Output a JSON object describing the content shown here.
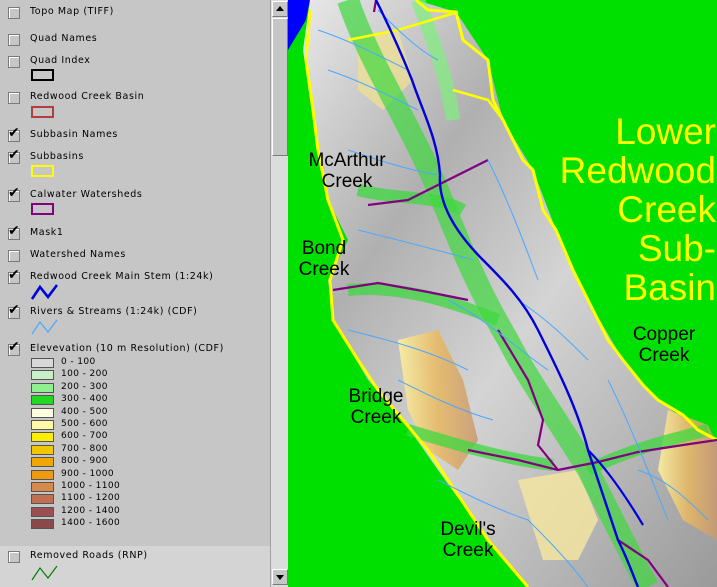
{
  "legend": {
    "layers": [
      {
        "name": "Topo Map (TIFF)",
        "checked": false
      },
      {
        "name": "Quad Names",
        "checked": false
      },
      {
        "name": "Quad Index",
        "checked": false
      },
      {
        "name": "Redwood Creek Basin",
        "checked": false
      },
      {
        "name": "Subbasin Names",
        "checked": true
      },
      {
        "name": "Subbasins",
        "checked": true
      },
      {
        "name": "Calwater Watersheds",
        "checked": true
      },
      {
        "name": "Mask1",
        "checked": true
      },
      {
        "name": "Watershed Names",
        "checked": false
      },
      {
        "name": "Redwood Creek Main Stem (1:24k)",
        "checked": true
      },
      {
        "name": "Rivers & Streams (1:24k) (CDF)",
        "checked": true
      },
      {
        "name": "Elevevation (10 m Resolution) (CDF)",
        "checked": true
      },
      {
        "name": "Removed Roads (RNP)",
        "checked": false
      }
    ],
    "elevation_classes": [
      {
        "label": "0 - 100",
        "color": "#d8d8d8"
      },
      {
        "label": "100 - 200",
        "color": "#c8f0c8"
      },
      {
        "label": "200 - 300",
        "color": "#90f090"
      },
      {
        "label": "300 - 400",
        "color": "#22d822"
      },
      {
        "label": "400 - 500",
        "color": "#fffde0"
      },
      {
        "label": "500 - 600",
        "color": "#fff8a8"
      },
      {
        "label": "600 - 700",
        "color": "#ffee00"
      },
      {
        "label": "700 - 800",
        "color": "#f0c800"
      },
      {
        "label": "800 - 900",
        "color": "#f0a800"
      },
      {
        "label": "900 - 1000",
        "color": "#ee9a10"
      },
      {
        "label": "1000 - 1100",
        "color": "#d88a4a"
      },
      {
        "label": "1100 - 1200",
        "color": "#c07050"
      },
      {
        "label": "1200 - 1400",
        "color": "#9a5050"
      },
      {
        "label": "1400 - 1600",
        "color": "#8a4848"
      }
    ],
    "colors": {
      "quad_index": "#c8c8c8",
      "redwood_basin": "#b04040",
      "subbasins": "#ffff00",
      "calwater": "#800080",
      "main_stem": "#0000dd",
      "streams": "#4aa8ff",
      "removed_roads": "#008000"
    }
  },
  "map": {
    "title": "Lower\nRedwood\nCreek\nSub-\nBasin",
    "labels": {
      "mcarthur": "McArthur\nCreek",
      "bond": "Bond\nCreek",
      "copper": "Copper\nCreek",
      "bridge": "Bridge\nCreek",
      "devils": "Devil's\nCreek"
    },
    "colors": {
      "mask": "#00e000",
      "ocean": "#0000ff"
    }
  }
}
